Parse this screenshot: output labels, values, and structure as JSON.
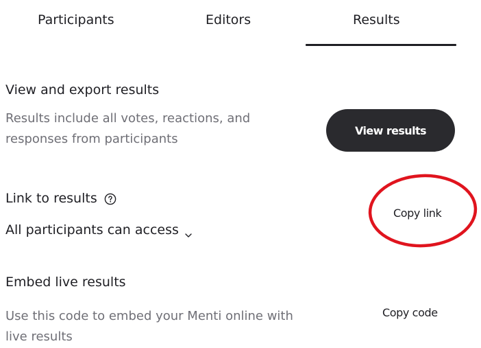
{
  "tabs": [
    {
      "label": "Participants"
    },
    {
      "label": "Editors"
    },
    {
      "label": "Results",
      "active": true
    }
  ],
  "view_section": {
    "heading": "View and export results",
    "description_line1": "Results include all votes, reactions, and",
    "description_line2": "responses from participants",
    "button_label": "View results"
  },
  "link_section": {
    "heading": "Link to results",
    "help_icon": "question-circle-icon",
    "access_label": "All participants can access",
    "access_icon": "chevron-down-icon",
    "button_label": "Copy link"
  },
  "embed_section": {
    "heading": "Embed live results",
    "description_line1": "Use this code to embed your Menti online with",
    "description_line2": "live results",
    "button_label": "Copy code"
  },
  "colors": {
    "text": "#1e1e23",
    "muted_text": "#6f6f76",
    "button_bg": "#2a2a2e",
    "annotation": "#e0141e"
  }
}
